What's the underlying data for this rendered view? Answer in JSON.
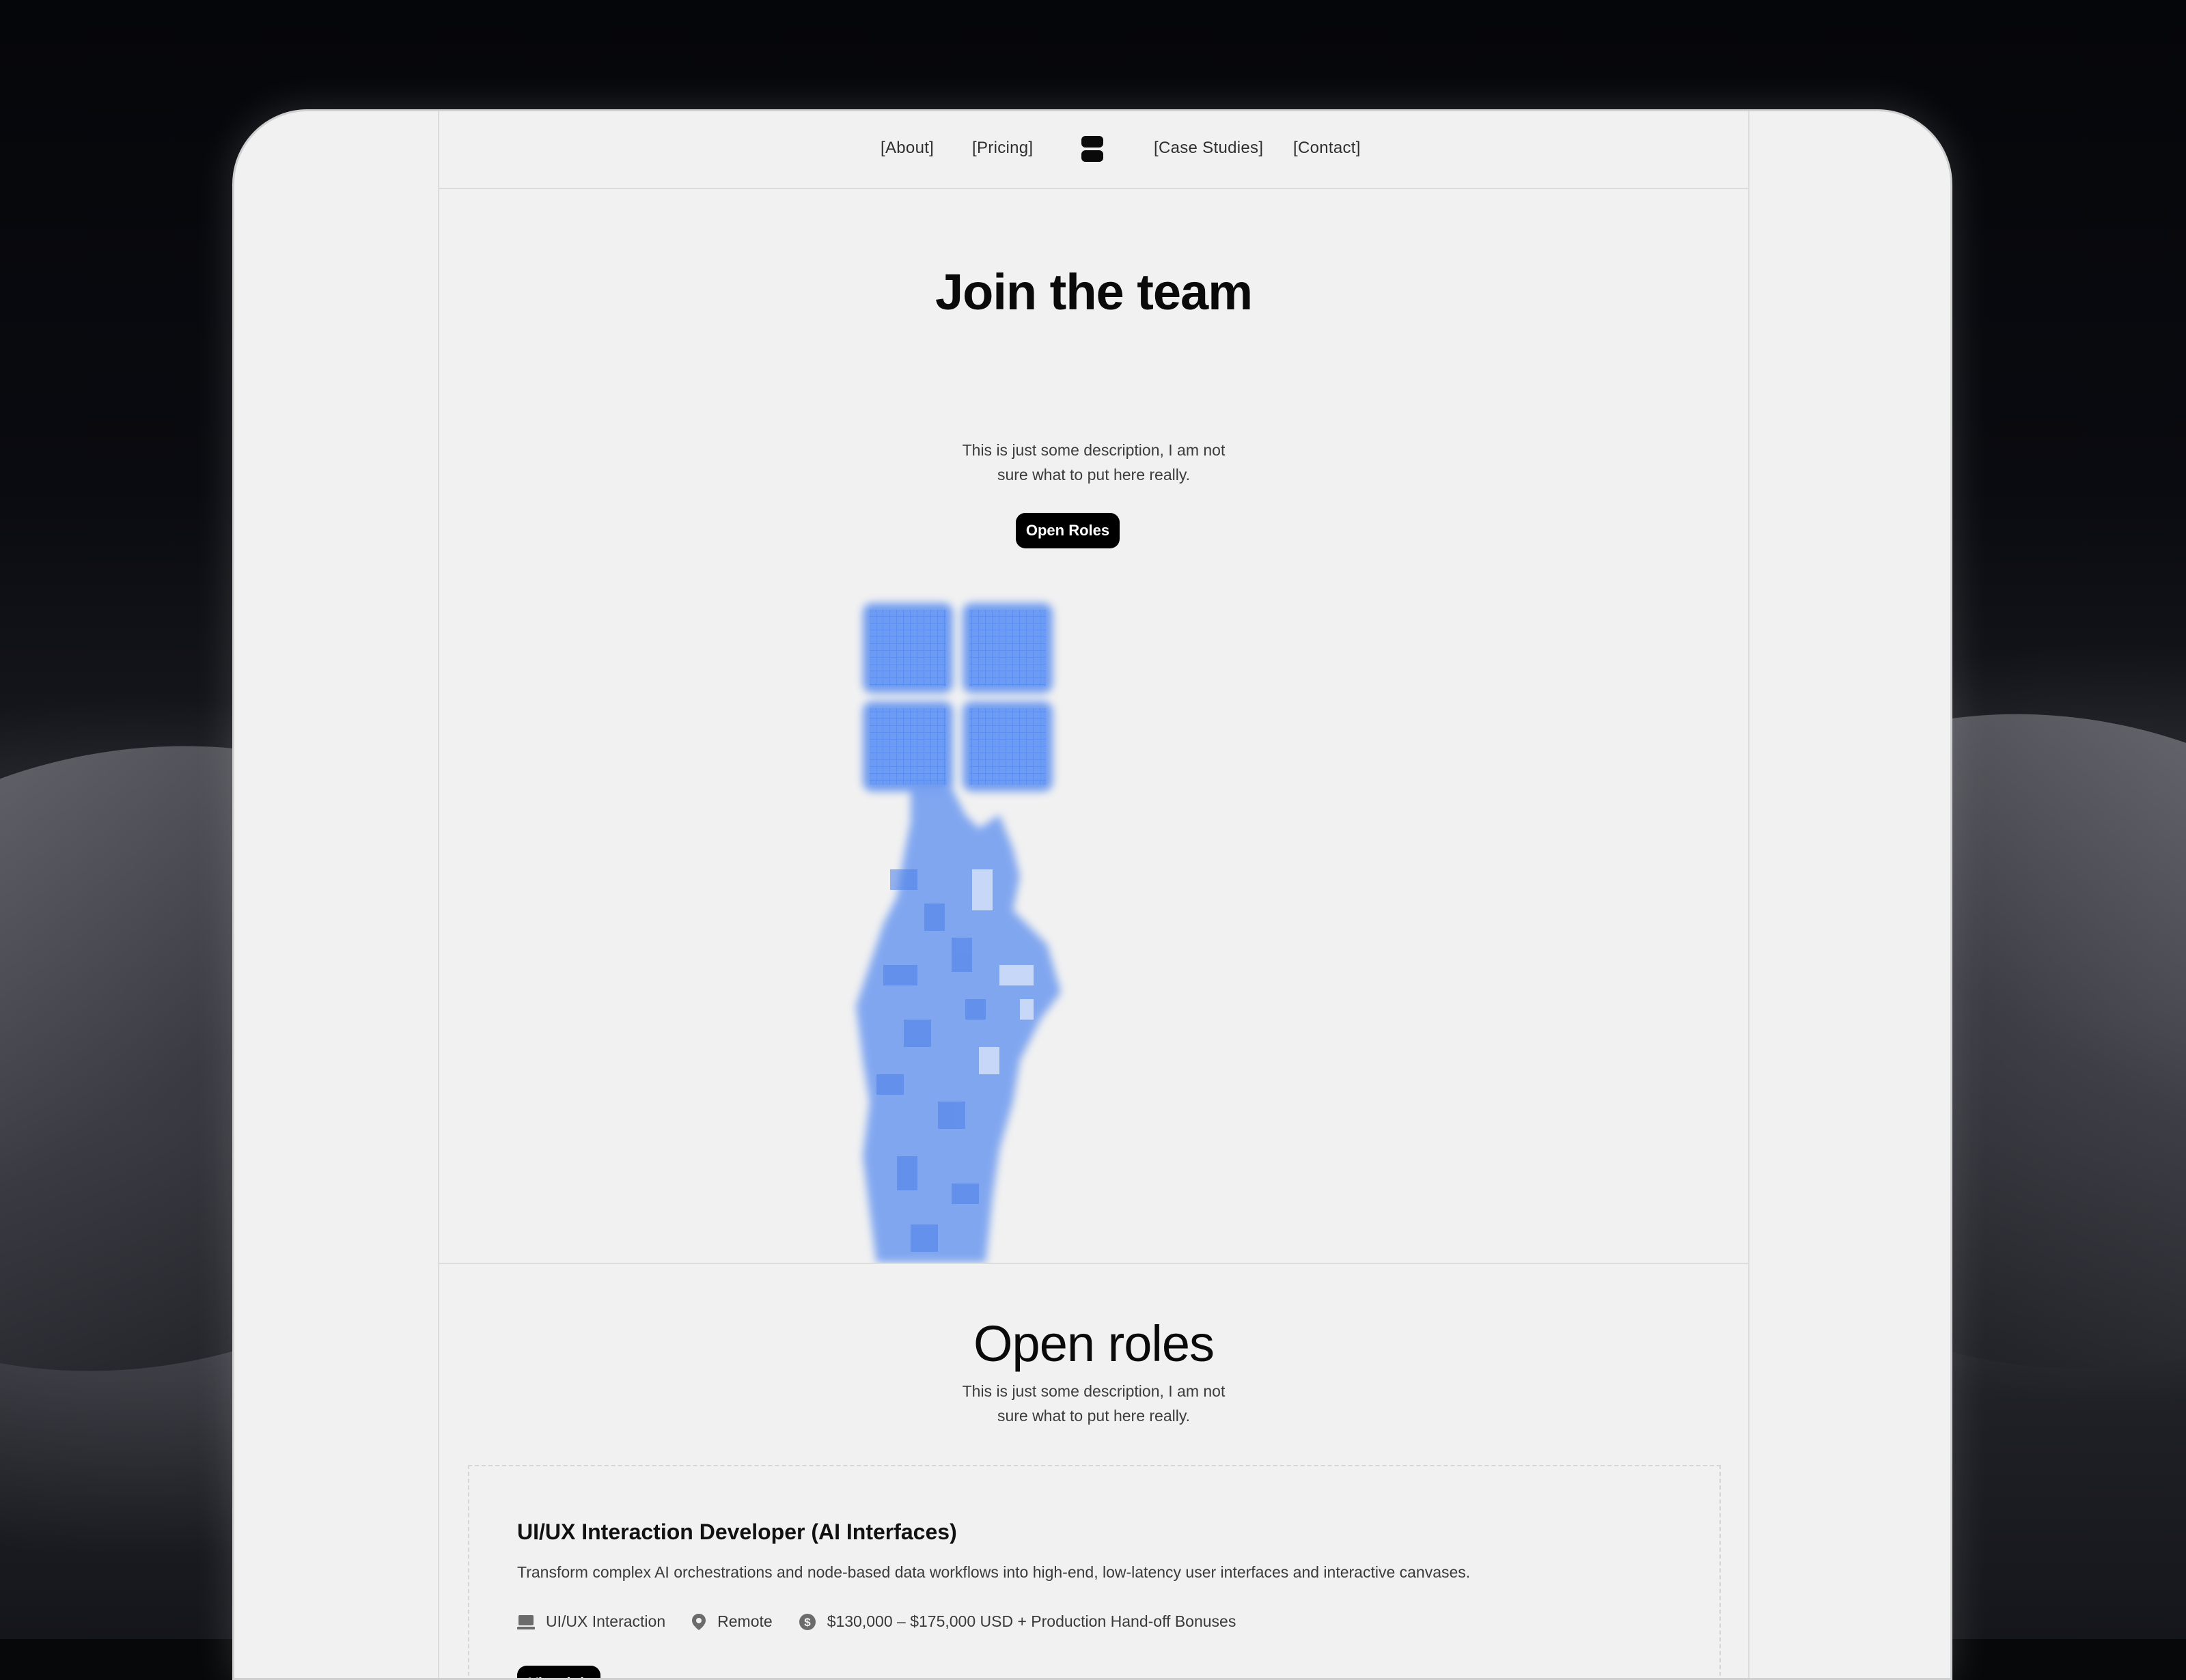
{
  "nav": {
    "about": "[About]",
    "pricing": "[Pricing]",
    "case_studies": "[Case Studies]",
    "contact": "[Contact]"
  },
  "hero": {
    "title": "Join the team",
    "description_line1": "This is just some description, I am not",
    "description_line2": "sure what to put here really.",
    "cta": "Open Roles",
    "figure_color": "#5b8ef0"
  },
  "roles_section": {
    "title": "Open roles",
    "description_line1": "This is just some description, I am not",
    "description_line2": "sure what to put here really."
  },
  "jobs": [
    {
      "title": "UI/UX Interaction Developer (AI Interfaces)",
      "description": "Transform complex AI orchestrations and node-based data workflows into high-end, low-latency user interfaces and interactive canvases.",
      "category": "UI/UX Interaction",
      "location": "Remote",
      "salary": "$130,000 – $175,000 USD + Production Hand-off Bonuses",
      "cta": "View job"
    }
  ]
}
